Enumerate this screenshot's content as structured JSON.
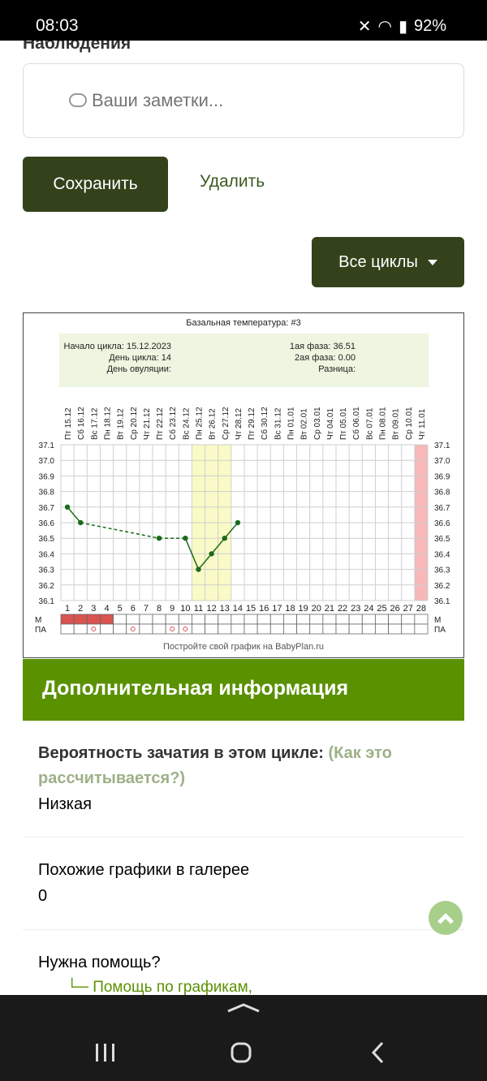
{
  "status": {
    "time": "08:03",
    "battery": "92%"
  },
  "observations": {
    "title": "Наблюдения",
    "placeholder": "Ваши заметки..."
  },
  "actions": {
    "save": "Сохранить",
    "delete": "Удалить",
    "cycles": "Все циклы"
  },
  "chart_data": {
    "type": "line",
    "title": "Базальная температура: #3",
    "info_left": [
      "Начало цикла: 15.12.2023",
      "День цикла: 14",
      "День овуляции:"
    ],
    "info_right": [
      "1ая фаза: 36.51",
      "2ая фаза: 0.00",
      "Разница:"
    ],
    "dates": [
      "Пт 15.12",
      "Сб 16.12",
      "Вс 17.12",
      "Пн 18.12",
      "Вт 19.12",
      "Ср 20.12",
      "Чт 21.12",
      "Пт 22.12",
      "Сб 23.12",
      "Вс 24.12",
      "Пн 25.12",
      "Вт 26.12",
      "Ср 27.12",
      "Чт 28.12",
      "Пт 29.12",
      "Сб 30.12",
      "Вс 31.12",
      "Пн 01.01",
      "Вт 02.01",
      "Ср 03.01",
      "Чт 04.01",
      "Пт 05.01",
      "Сб 06.01",
      "Вс 07.01",
      "Пн 08.01",
      "Вт 09.01",
      "Ср 10.01",
      "Чт 11.01"
    ],
    "y_ticks": [
      "37.1",
      "37.0",
      "36.9",
      "36.8",
      "36.7",
      "36.6",
      "36.5",
      "36.4",
      "36.3",
      "36.2",
      "36.1"
    ],
    "days": [
      "1",
      "2",
      "3",
      "4",
      "5",
      "6",
      "7",
      "8",
      "9",
      "10",
      "11",
      "12",
      "13",
      "14",
      "15",
      "16",
      "17",
      "18",
      "19",
      "20",
      "21",
      "22",
      "23",
      "24",
      "25",
      "26",
      "27",
      "28"
    ],
    "points": [
      {
        "day": 1,
        "temp": 36.7
      },
      {
        "day": 2,
        "temp": 36.6
      },
      {
        "day": 8,
        "temp": 36.5
      },
      {
        "day": 10,
        "temp": 36.5
      },
      {
        "day": 11,
        "temp": 36.3
      },
      {
        "day": 12,
        "temp": 36.4
      },
      {
        "day": 13,
        "temp": 36.5
      },
      {
        "day": 14,
        "temp": 36.6
      }
    ],
    "ylim": [
      36.1,
      37.1
    ],
    "highlight_days": [
      11,
      12,
      13
    ],
    "highlight_color": "#fafac6",
    "end_marker_day": 28,
    "end_marker_color": "#f6b8b8",
    "row_m_label": "М",
    "row_pa_label": "ПА",
    "m_days": [
      1,
      2,
      3,
      4
    ],
    "pa_days": [
      3,
      6,
      9,
      10
    ],
    "footer": "Постройте свой график на BabyPlan.ru",
    "line_color": "#1a6b1a"
  },
  "additional": {
    "header": "Дополнительная информация",
    "prob_label": "Вероятность зачатия в этом цикле:",
    "prob_link": "(Как это рассчитывается?)",
    "prob_value": "Низкая",
    "similar_label": "Похожие графики в галерее",
    "similar_value": "0",
    "help_label": "Нужна помощь?",
    "help_link": "└─ Помощь по графикам,"
  }
}
